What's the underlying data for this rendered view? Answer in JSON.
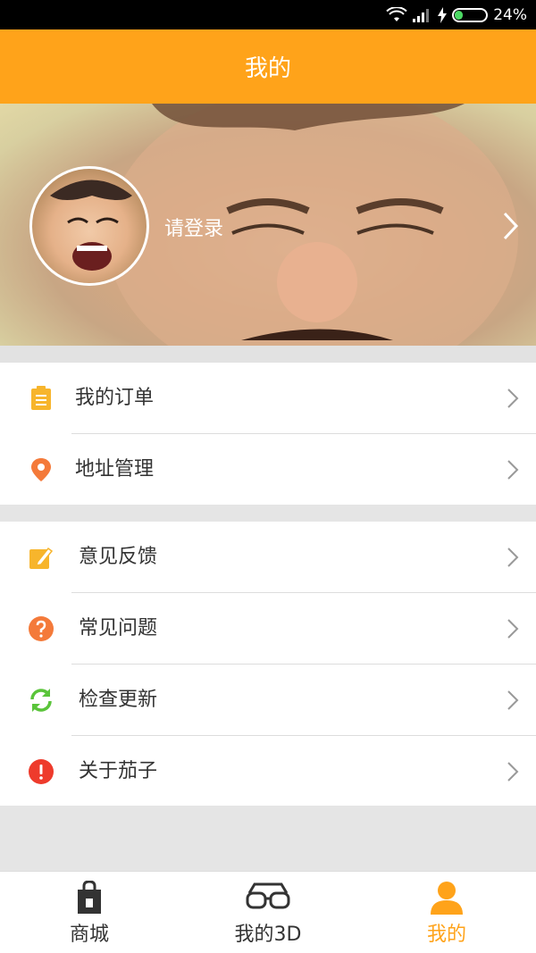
{
  "status_bar": {
    "battery": "24%"
  },
  "header": {
    "title": "我的"
  },
  "profile": {
    "login_prompt": "请登录"
  },
  "menu_group_1": [
    {
      "label": "我的订单",
      "icon": "clipboard-icon"
    },
    {
      "label": "地址管理",
      "icon": "location-pin-icon"
    }
  ],
  "menu_group_2": [
    {
      "label": "意见反馈",
      "icon": "edit-icon"
    },
    {
      "label": "常见问题",
      "icon": "question-icon"
    },
    {
      "label": "检查更新",
      "icon": "refresh-icon"
    },
    {
      "label": "关于茄子",
      "icon": "info-alert-icon"
    }
  ],
  "tabbar": [
    {
      "label": "商城",
      "icon": "shopping-bag-icon"
    },
    {
      "label": "我的3D",
      "icon": "3d-glasses-icon"
    },
    {
      "label": "我的",
      "icon": "person-icon",
      "active": true
    }
  ],
  "colors": {
    "accent": "#ffa31a"
  }
}
